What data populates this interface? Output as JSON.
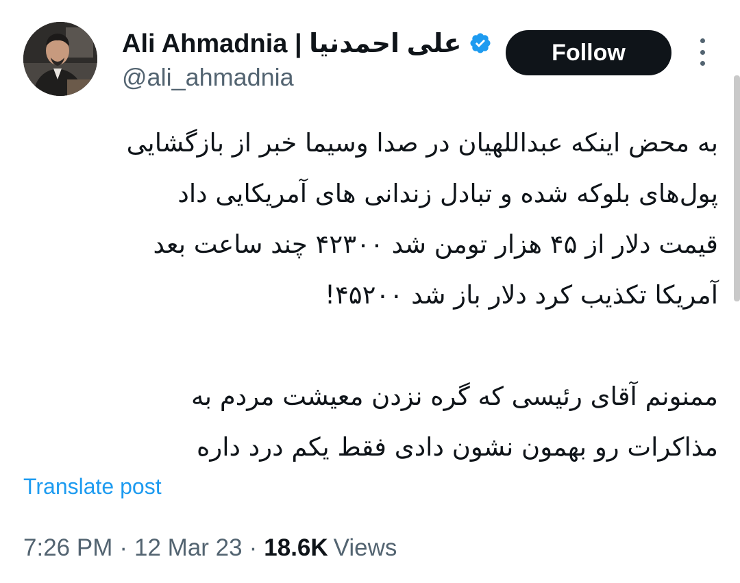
{
  "author": {
    "display_name": "Ali Ahmadnia | علی احمدنیا",
    "handle": "@ali_ahmadnia",
    "verified": true
  },
  "actions": {
    "follow_label": "Follow"
  },
  "icons": {
    "verified": "verified-badge-icon",
    "more": "more-vertical-icon"
  },
  "tweet": {
    "paragraph1": [
      "به محض اینکه عبداللهیان در صدا وسیما خبر از بازگشایی",
      "پول‌های بلوکه شده و تبادل زندانی های آمریکایی داد",
      "قیمت دلار از ۴۵ هزار تومن شد ۴۲۳۰۰ چند ساعت بعد",
      "آمریکا تکذیب کرد دلار باز شد ۴۵۲۰۰!"
    ],
    "paragraph2": [
      "ممنونم آقای رئیسی که گره نزدن معیشت مردم به",
      "مذاکرات رو بهمون نشون دادی فقط یکم درد داره"
    ],
    "translate_label": "Translate post"
  },
  "meta": {
    "time": "7:26 PM",
    "date": "12 Mar 23",
    "views_count": "18.6K",
    "views_label": "Views",
    "separator": "·"
  },
  "colors": {
    "text_primary": "#0f1419",
    "text_secondary": "#536471",
    "link": "#1d9bf0",
    "verified": "#1d9bf0",
    "follow_bg": "#0f1419"
  }
}
